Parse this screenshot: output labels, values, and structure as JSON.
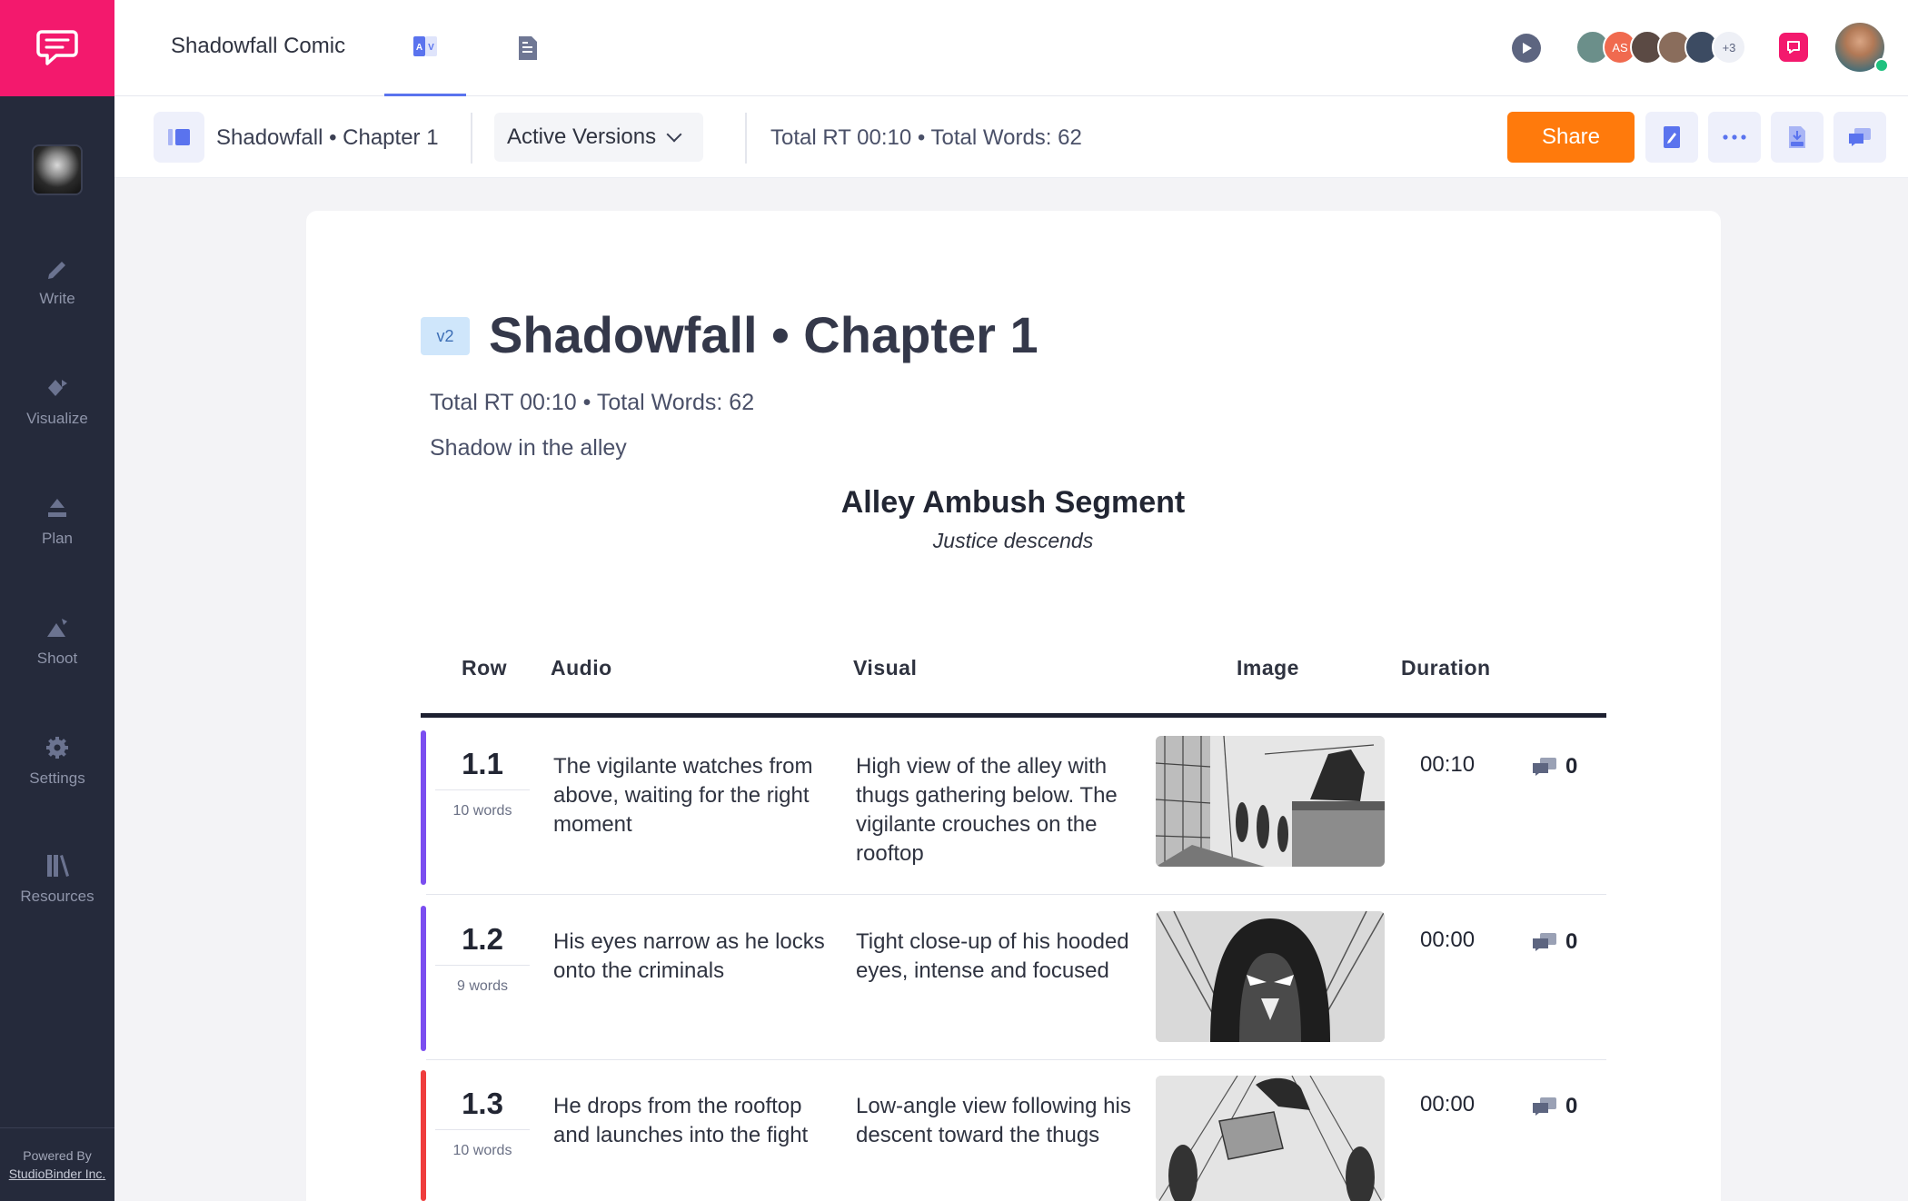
{
  "app": {
    "title": "Shadowfall Comic"
  },
  "sidebar": {
    "items": [
      {
        "label": "Write",
        "icon": "pencil-icon"
      },
      {
        "label": "Visualize",
        "icon": "diamond-icon"
      },
      {
        "label": "Plan",
        "icon": "mountain-icon"
      },
      {
        "label": "Shoot",
        "icon": "camera-icon"
      },
      {
        "label": "Settings",
        "icon": "gear-icon"
      },
      {
        "label": "Resources",
        "icon": "books-icon"
      }
    ],
    "powered_by": "Powered By",
    "company": "StudioBinder Inc."
  },
  "header": {
    "tab_av_label": "A V",
    "collaborators": {
      "initials": "AS",
      "more": "+3"
    }
  },
  "toolbar": {
    "doc_title": "Shadowfall • Chapter 1",
    "versions_label": "Active Versions",
    "stats": "Total RT 00:10 • Total Words: 62",
    "share_label": "Share"
  },
  "document": {
    "version": "v2",
    "title": "Shadowfall • Chapter 1",
    "stats": "Total RT 00:10 • Total Words: 62",
    "subtitle": "Shadow in the alley",
    "segment": {
      "title": "Alley Ambush Segment",
      "tagline": "Justice descends"
    },
    "columns": {
      "row": "Row",
      "audio": "Audio",
      "visual": "Visual",
      "image": "Image",
      "duration": "Duration"
    },
    "rows": [
      {
        "num": "1.1",
        "words": "10 words",
        "audio": "The vigilante watches from above, waiting for the right moment",
        "visual": "High view of the alley with thugs gathering below. The vigilante crouches on the rooftop",
        "duration": "00:10",
        "comments": "0",
        "color": "#7b4ef0"
      },
      {
        "num": "1.2",
        "words": "9 words",
        "audio": "His eyes narrow as he locks onto the criminals",
        "visual": "Tight close-up of his hooded eyes, intense and focused",
        "duration": "00:00",
        "comments": "0",
        "color": "#7b4ef0"
      },
      {
        "num": "1.3",
        "words": "10 words",
        "audio": "He drops from the rooftop and launches into the fight",
        "visual": "Low-angle view following his descent toward the thugs",
        "duration": "00:00",
        "comments": "0",
        "color": "#ef3d3d"
      }
    ]
  }
}
